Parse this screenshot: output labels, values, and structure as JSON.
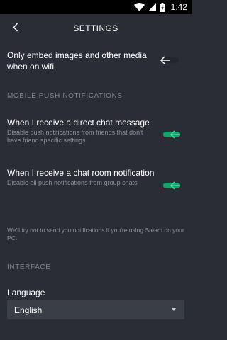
{
  "status_bar": {
    "time": "1:42",
    "battery_icon": "battery-charging-icon",
    "signal_icon": "cell-signal-icon",
    "wifi_icon": "wifi-icon"
  },
  "header": {
    "title": "SETTINGS",
    "back_icon": "chevron-left-icon"
  },
  "embed_wifi": {
    "label": "Only embed images and other media when on wifi",
    "enabled": false
  },
  "push_section": {
    "title": "MOBILE PUSH NOTIFICATIONS",
    "items": [
      {
        "label": "When I receive a direct chat message",
        "description": "Disable push notifications from friends that don't have friend specific settings",
        "enabled": true
      },
      {
        "label": "When I receive a chat room notification",
        "description": "Disable all push notifications from group chats",
        "enabled": true
      }
    ],
    "note": "We'll try not to send you notifications if you're using Steam on your PC."
  },
  "interface_section": {
    "title": "INTERFACE",
    "language_label": "Language",
    "language_value": "English"
  },
  "colors": {
    "background": "#2a2d35",
    "toggle_on": "#1a9f6a",
    "toggle_off": "#23262c",
    "muted_text": "#8b8f97"
  }
}
